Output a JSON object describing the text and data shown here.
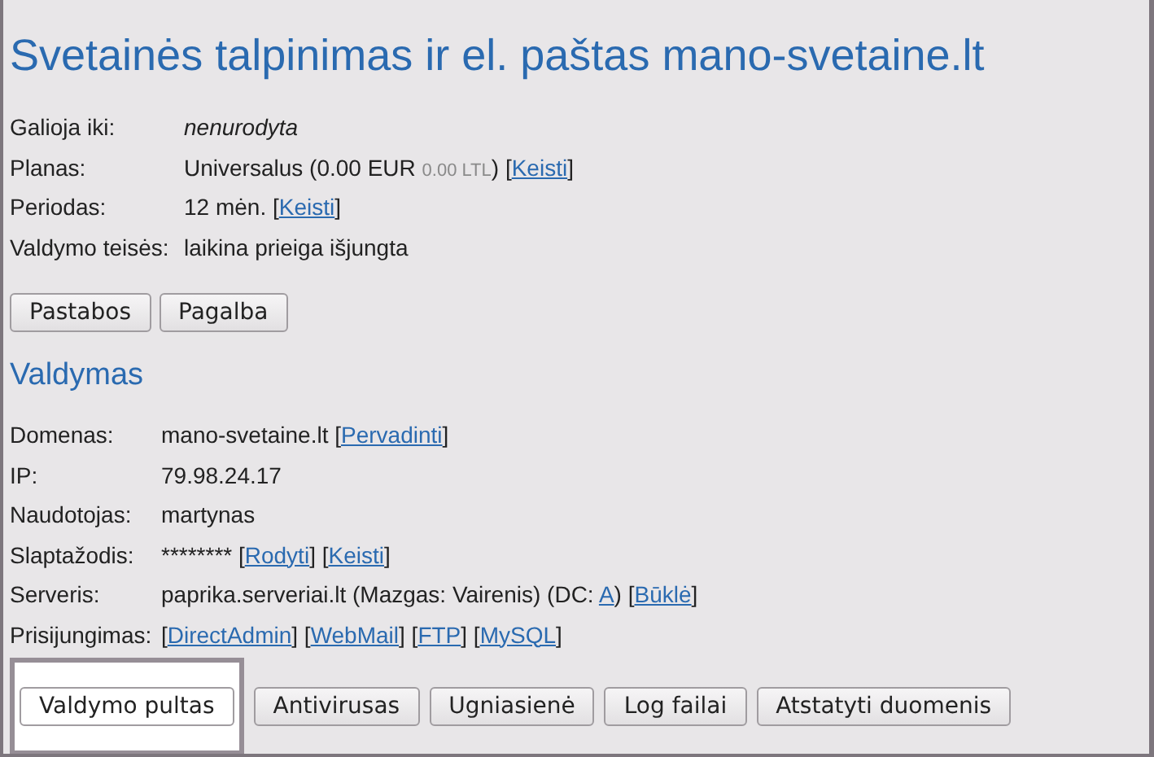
{
  "title": "Svetainės talpinimas ir el. paštas mano-svetaine.lt",
  "info": [
    {
      "label": "Galioja iki:",
      "parts": [
        {
          "kind": "italic",
          "text": "nenurodyta"
        }
      ]
    },
    {
      "label": "Planas:",
      "parts": [
        {
          "kind": "text",
          "text": "Universalus (0.00 EUR"
        },
        {
          "kind": "muted",
          "text": "0.00 LTL"
        },
        {
          "kind": "text",
          "text": ") ["
        },
        {
          "kind": "link",
          "text": "Keisti"
        },
        {
          "kind": "text",
          "text": "]"
        }
      ]
    },
    {
      "label": "Periodas:",
      "parts": [
        {
          "kind": "text",
          "text": "12 mėn. ["
        },
        {
          "kind": "link",
          "text": "Keisti"
        },
        {
          "kind": "text",
          "text": "]"
        }
      ]
    },
    {
      "label": "Valdymo teisės:",
      "parts": [
        {
          "kind": "text",
          "text": "laikina prieiga išjungta"
        }
      ]
    }
  ],
  "info_buttons": [
    {
      "label": "Pastabos",
      "selected": false
    },
    {
      "label": "Pagalba",
      "selected": false
    }
  ],
  "section_title": "Valdymas",
  "details": [
    {
      "label": "Domenas:",
      "parts": [
        {
          "kind": "text",
          "text": "mano-svetaine.lt ["
        },
        {
          "kind": "link",
          "text": "Pervadinti"
        },
        {
          "kind": "text",
          "text": "]"
        }
      ]
    },
    {
      "label": "IP:",
      "parts": [
        {
          "kind": "text",
          "text": "79.98.24.17"
        }
      ]
    },
    {
      "label": "Naudotojas:",
      "parts": [
        {
          "kind": "text",
          "text": "martynas"
        }
      ]
    },
    {
      "label": "Slaptažodis:",
      "parts": [
        {
          "kind": "text",
          "text": "******** ["
        },
        {
          "kind": "link",
          "text": "Rodyti"
        },
        {
          "kind": "text",
          "text": "] ["
        },
        {
          "kind": "link",
          "text": "Keisti"
        },
        {
          "kind": "text",
          "text": "]"
        }
      ]
    },
    {
      "label": "Serveris:",
      "parts": [
        {
          "kind": "text",
          "text": "paprika.serveriai.lt (Mazgas: Vairenis) (DC:"
        },
        {
          "kind": "link",
          "text": "A"
        },
        {
          "kind": "text",
          "text": ") ["
        },
        {
          "kind": "link",
          "text": "Būklė"
        },
        {
          "kind": "text",
          "text": "]"
        }
      ]
    },
    {
      "label": "Prisijungimas:",
      "parts": [
        {
          "kind": "text",
          "text": "["
        },
        {
          "kind": "link",
          "text": "DirectAdmin"
        },
        {
          "kind": "text",
          "text": "] ["
        },
        {
          "kind": "link",
          "text": "WebMail"
        },
        {
          "kind": "text",
          "text": "] ["
        },
        {
          "kind": "link",
          "text": "FTP"
        },
        {
          "kind": "text",
          "text": "] ["
        },
        {
          "kind": "link",
          "text": "MySQL"
        },
        {
          "kind": "text",
          "text": "]"
        }
      ]
    }
  ],
  "control_buttons": [
    {
      "label": "Valdymo pultas",
      "selected": true
    },
    {
      "label": "Antivirusas",
      "selected": false
    },
    {
      "label": "Ugniasienė",
      "selected": false
    },
    {
      "label": "Log failai",
      "selected": false
    },
    {
      "label": "Atstatyti duomenis",
      "selected": false
    }
  ]
}
